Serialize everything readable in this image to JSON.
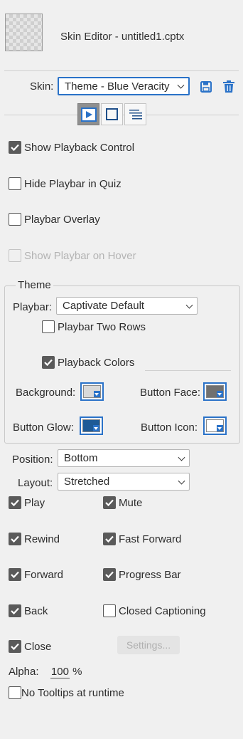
{
  "header": {
    "title": "Skin Editor - untitled1.cptx"
  },
  "skin": {
    "label": "Skin:",
    "selected": "Theme - Blue Veracity",
    "save_icon": "save-icon",
    "delete_icon": "trash-icon"
  },
  "modes": [
    {
      "name": "playback-control",
      "icon": "play-icon",
      "active": true
    },
    {
      "name": "borders",
      "icon": "square-icon",
      "active": false
    },
    {
      "name": "toc",
      "icon": "toc-icon",
      "active": false
    }
  ],
  "options": {
    "show_playback_control": {
      "label": "Show Playback Control",
      "checked": true
    },
    "hide_playbar_in_quiz": {
      "label": "Hide Playbar in Quiz",
      "checked": false
    },
    "playbar_overlay": {
      "label": "Playbar Overlay",
      "checked": false
    },
    "show_playbar_on_hover": {
      "label": "Show Playbar on Hover",
      "checked": false,
      "disabled": true
    }
  },
  "theme": {
    "legend": "Theme",
    "playbar_label": "Playbar:",
    "playbar_selected": "Captivate Default",
    "two_rows": {
      "label": "Playbar Two Rows",
      "checked": false
    },
    "playback_colors": {
      "label": "Playback Colors",
      "checked": true
    },
    "background_label": "Background:",
    "button_face_label": "Button Face:",
    "button_glow_label": "Button Glow:",
    "button_icon_label": "Button Icon:",
    "colors": {
      "background": "#d9d9d9",
      "button_face": "#707070",
      "button_glow": "#1e5a96",
      "button_icon": "#ffffff",
      "accent": "#2a72c8"
    }
  },
  "position": {
    "label": "Position:",
    "selected": "Bottom"
  },
  "layout": {
    "label": "Layout:",
    "selected": "Stretched"
  },
  "controls": {
    "play": {
      "label": "Play",
      "checked": true
    },
    "mute": {
      "label": "Mute",
      "checked": true
    },
    "rewind": {
      "label": "Rewind",
      "checked": true
    },
    "fast_forward": {
      "label": "Fast Forward",
      "checked": true
    },
    "forward": {
      "label": "Forward",
      "checked": true
    },
    "progress_bar": {
      "label": "Progress Bar",
      "checked": true
    },
    "back": {
      "label": "Back",
      "checked": true
    },
    "closed_captioning": {
      "label": "Closed Captioning",
      "checked": false
    },
    "close": {
      "label": "Close",
      "checked": true
    },
    "settings_label": "Settings..."
  },
  "alpha": {
    "label": "Alpha:",
    "value": "100",
    "unit": "%"
  },
  "no_tooltips": {
    "label": "No Tooltips at runtime",
    "checked": false
  }
}
